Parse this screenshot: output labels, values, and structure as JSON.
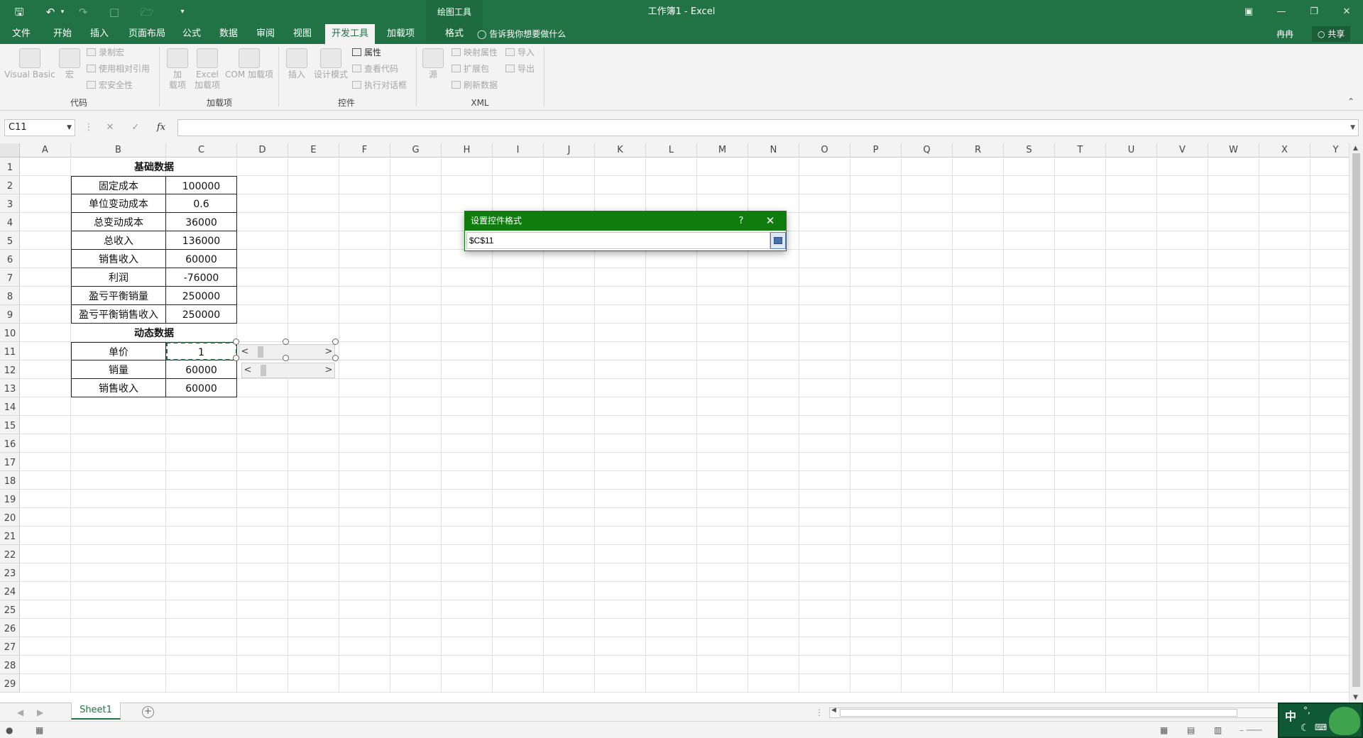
{
  "titlebar": {
    "context_tab_group": "绘图工具",
    "document_title": "工作簿1 - Excel"
  },
  "tabs": {
    "items": [
      "文件",
      "开始",
      "插入",
      "页面布局",
      "公式",
      "数据",
      "审阅",
      "视图",
      "开发工具",
      "加载项",
      "格式"
    ],
    "active": "开发工具",
    "tell_me": "告诉我你想要做什么",
    "user": "冉冉",
    "share": "共享"
  },
  "ribbon": {
    "code": {
      "group_label": "代码",
      "visual_basic": "Visual Basic",
      "macros": "宏",
      "record_macro": "录制宏",
      "relative_ref": "使用相对引用",
      "macro_security": "宏安全性"
    },
    "addins": {
      "group_label": "加载项",
      "addins_line1": "加",
      "addins_line2": "载项",
      "excel_addins_line1": "Excel",
      "excel_addins_line2": "加载项",
      "com_addins": "COM 加载项"
    },
    "controls": {
      "group_label": "控件",
      "insert": "插入",
      "design_mode": "设计模式",
      "properties": "属性",
      "view_code": "查看代码",
      "run_dialog": "执行对话框"
    },
    "xml": {
      "group_label": "XML",
      "source": "源",
      "map_properties": "映射属性",
      "expansion_packs": "扩展包",
      "refresh_data": "刷新数据",
      "import": "导入",
      "export": "导出"
    }
  },
  "formula_bar": {
    "name_box": "C11",
    "cancel_glyph": "✕",
    "enter_glyph": "✓",
    "fx": "fx",
    "formula": ""
  },
  "columns": [
    "A",
    "B",
    "C",
    "D",
    "E",
    "F",
    "G",
    "H",
    "I",
    "J",
    "K",
    "L",
    "M",
    "N",
    "O",
    "P",
    "Q",
    "R",
    "S",
    "T",
    "U",
    "V",
    "W",
    "X",
    "Y"
  ],
  "rows": [
    "1",
    "2",
    "3",
    "4",
    "5",
    "6",
    "7",
    "8",
    "9",
    "10",
    "11",
    "12",
    "13",
    "14",
    "15",
    "16",
    "17",
    "18",
    "19",
    "20",
    "21",
    "22",
    "23",
    "24",
    "25",
    "26",
    "27",
    "28",
    "29"
  ],
  "sheet": {
    "basic_header": "基础数据",
    "basic": [
      {
        "label": "固定成本",
        "value": "100000"
      },
      {
        "label": "单位变动成本",
        "value": "0.6"
      },
      {
        "label": "总变动成本",
        "value": "36000"
      },
      {
        "label": "总收入",
        "value": "136000"
      },
      {
        "label": "销售收入",
        "value": "60000"
      },
      {
        "label": "利润",
        "value": "-76000"
      },
      {
        "label": "盈亏平衡销量",
        "value": "250000"
      },
      {
        "label": "盈亏平衡销售收入",
        "value": "250000"
      }
    ],
    "dynamic_header": "动态数据",
    "dynamic": [
      {
        "label": "单价",
        "value": "1"
      },
      {
        "label": "销量",
        "value": "60000"
      },
      {
        "label": "销售收入",
        "value": "60000"
      }
    ]
  },
  "dialog": {
    "title": "设置控件格式",
    "help": "?",
    "close": "✕",
    "ref_value": "$C$11"
  },
  "sheet_tabs": {
    "active": "Sheet1",
    "add": "+"
  },
  "ime": {
    "lang": "中",
    "punct": "°,"
  },
  "colors": {
    "excel_green": "#217346",
    "dialog_green": "#107c10"
  }
}
